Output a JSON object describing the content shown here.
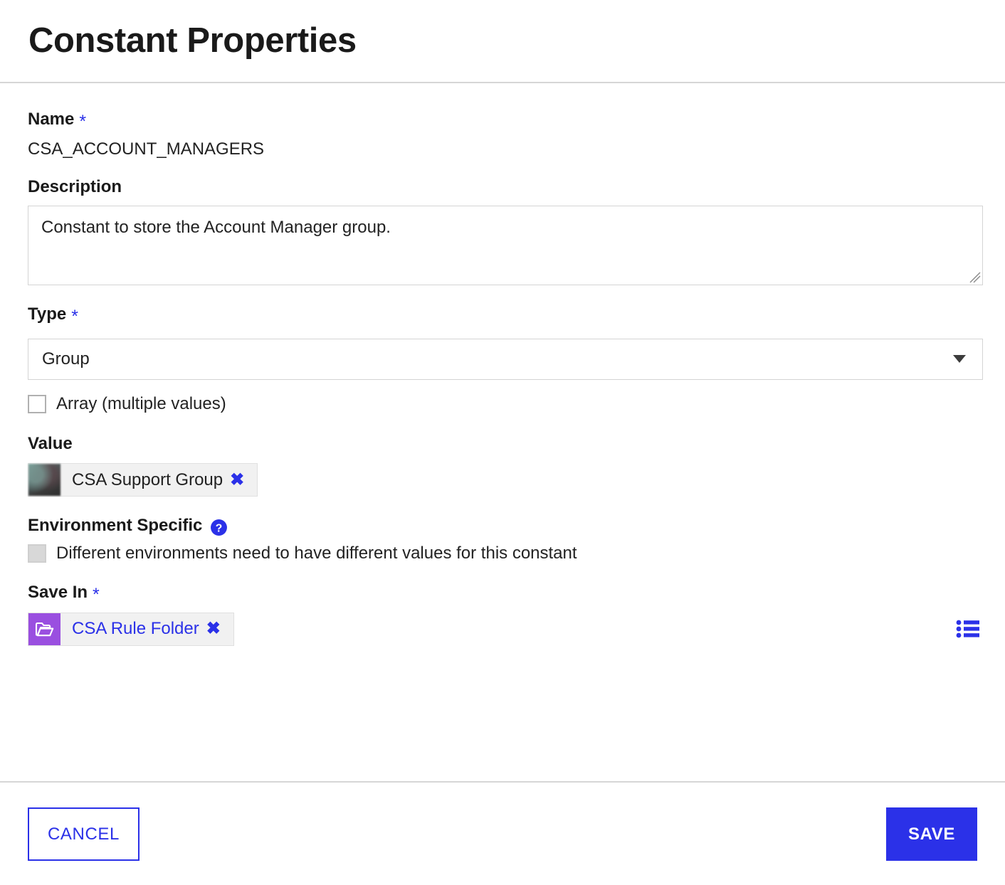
{
  "dialog": {
    "title": "Constant Properties"
  },
  "fields": {
    "name": {
      "label": "Name",
      "required_marker": "*",
      "value": "CSA_ACCOUNT_MANAGERS"
    },
    "description": {
      "label": "Description",
      "value": "Constant to store the Account Manager group.",
      "placeholder": ""
    },
    "type": {
      "label": "Type",
      "required_marker": "*",
      "selected": "Group",
      "options": [
        "Group"
      ]
    },
    "array": {
      "label": "Array (multiple values)",
      "checked": false
    },
    "value": {
      "label": "Value",
      "chip_text": "CSA Support Group",
      "chip_remove": "✖",
      "chip_icon": "user-avatar-thumbnail"
    },
    "environment_specific": {
      "label": "Environment Specific",
      "help_icon": "help-circle-icon",
      "checkbox_label": "Different environments need to have different values for this constant",
      "checked": false,
      "disabled": true
    },
    "save_in": {
      "label": "Save In",
      "required_marker": "*",
      "chip_text": "CSA Rule Folder",
      "chip_remove": "✖",
      "chip_icon": "folder-open-icon",
      "browse_icon": "list-icon"
    }
  },
  "footer": {
    "cancel_label": "CANCEL",
    "save_label": "SAVE"
  },
  "colors": {
    "accent": "#2b31e8",
    "folder": "#9a4fe0",
    "border": "#d4d4d4",
    "divider": "#d6d6d6",
    "chip_bg": "#f1f1f1"
  }
}
